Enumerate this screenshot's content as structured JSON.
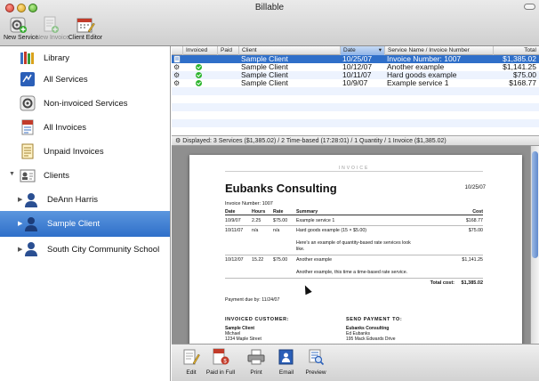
{
  "window": {
    "title": "Billable"
  },
  "toolbar": {
    "buttons": [
      {
        "label": "New Service",
        "icon": "gear-add-icon"
      },
      {
        "label": "New Invoice",
        "icon": "document-add-icon",
        "disabled": true
      },
      {
        "label": "Client Editor",
        "icon": "calendar-edit-icon"
      }
    ]
  },
  "sidebar": {
    "items": [
      {
        "label": "Library",
        "icon": "library-icon"
      },
      {
        "label": "All Services",
        "icon": "services-icon"
      },
      {
        "label": "Non-invoiced Services",
        "icon": "gear-icon"
      },
      {
        "label": "All Invoices",
        "icon": "invoices-icon"
      },
      {
        "label": "Unpaid Invoices",
        "icon": "unpaid-icon"
      },
      {
        "label": "Clients",
        "icon": "clients-icon"
      }
    ],
    "clients": [
      {
        "label": "DeAnn Harris",
        "selected": false
      },
      {
        "label": "Sample Client",
        "selected": true
      },
      {
        "label": "South City Community School",
        "selected": false
      }
    ]
  },
  "table": {
    "headers": [
      "",
      "Invoiced",
      "Paid",
      "Client",
      "Date",
      "Service Name / Invoice Number",
      "Total"
    ],
    "sorted_column": "Date",
    "rows": [
      {
        "client": "Sample Client",
        "date": "10/25/07",
        "name": "Invoice Number: 1007",
        "total": "$1,385.02",
        "type": "invoice",
        "invoiced": false,
        "selected": true
      },
      {
        "client": "Sample Client",
        "date": "10/12/07",
        "name": "Another example",
        "total": "$1,141.25",
        "type": "service",
        "invoiced": true,
        "selected": false
      },
      {
        "client": "Sample Client",
        "date": "10/11/07",
        "name": "Hard goods example",
        "total": "$75.00",
        "type": "service",
        "invoiced": true,
        "selected": false
      },
      {
        "client": "Sample Client",
        "date": "10/9/07",
        "name": "Example service 1",
        "total": "$168.77",
        "type": "service",
        "invoiced": true,
        "selected": false
      }
    ]
  },
  "status": {
    "text": "Displayed: 3 Services ($1,385.02) / 2 Time-based (17:28:01) / 1 Quantity / 1 Invoice ($1,385.02)"
  },
  "invoice": {
    "header_band": "INVOICE",
    "company": "Eubanks Consulting",
    "date": "10/25/07",
    "number_line": "Invoice Number: 1007",
    "columns": [
      "Date",
      "Hours",
      "Rate",
      "Summary",
      "Cost"
    ],
    "lines": [
      {
        "date": "10/9/07",
        "hours": "2.25",
        "rate": "$75.00",
        "summary": "Example service 1",
        "cost": "$168.77"
      },
      {
        "date": "10/11/07",
        "hours": "n/a",
        "rate": "n/a",
        "summary": "Hard goods example (15 × $5.00)",
        "cost": "$75.00"
      },
      {
        "date": "",
        "hours": "",
        "rate": "",
        "summary": "Here's an example of quantity-based rate services look",
        "cost": ""
      },
      {
        "date": "",
        "hours": "",
        "rate": "",
        "summary": "like.",
        "cost": ""
      },
      {
        "date": "10/12/07",
        "hours": "15.22",
        "rate": "$75.00",
        "summary": "Another example",
        "cost": "$1,141.25"
      },
      {
        "date": "",
        "hours": "",
        "rate": "",
        "summary": "Another example, this time a time-based rate service.",
        "cost": ""
      }
    ],
    "total_label": "Total cost:",
    "total_value": "$1,385.02",
    "payment_due": "Payment due by: 11/24/07",
    "invoiced_customer": {
      "heading": "INVOICED CUSTOMER:",
      "name": "Sample Client",
      "line1": "Michael",
      "line2": "1234 Maple Street"
    },
    "send_payment": {
      "heading": "SEND PAYMENT TO:",
      "name": "Eubanks Consulting",
      "line1": "Ed Eubanks",
      "line2": "195 Mack Edwards Drive"
    }
  },
  "bottom_toolbar": {
    "buttons": [
      {
        "label": "Edit",
        "icon": "edit-icon"
      },
      {
        "label": "Paid in Full",
        "icon": "paid-icon"
      },
      {
        "label": "Print",
        "icon": "printer-icon"
      },
      {
        "label": "Email",
        "icon": "email-icon"
      },
      {
        "label": "Preview",
        "icon": "preview-icon"
      }
    ]
  },
  "colors": {
    "selection": "#2f6fc9",
    "sorted_header": "#a9c6ee",
    "check_green": "#2db52d",
    "preview_background": "#8f8f8f"
  }
}
